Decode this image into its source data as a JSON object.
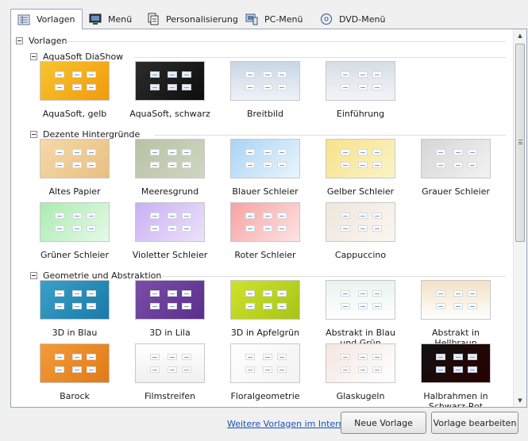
{
  "tabs": [
    {
      "label": "Vorlagen",
      "icon": "templates-icon",
      "active": true
    },
    {
      "label": "Menü",
      "icon": "monitor-icon",
      "active": false
    },
    {
      "label": "Personalisierung",
      "icon": "pages-icon",
      "active": false
    },
    {
      "label": "PC-Menü",
      "icon": "pc-menu-icon",
      "active": false
    },
    {
      "label": "DVD-Menü",
      "icon": "dvd-icon",
      "active": false
    }
  ],
  "tree": {
    "root_label": "Vorlagen",
    "groups": [
      {
        "label": "AquaSoft DiaShow",
        "items": [
          {
            "label": "AquaSoft, gelb",
            "bg": "linear-gradient(135deg,#f7c430,#f29a0c)"
          },
          {
            "label": "AquaSoft, schwarz",
            "bg": "linear-gradient(135deg,#2c2c2c,#0d0d0d)"
          },
          {
            "label": "Breitbild",
            "bg": "linear-gradient(180deg,#c9d6e6,#eef2f8)"
          },
          {
            "label": "Einführung",
            "bg": "linear-gradient(180deg,#d7dde6,#f2f4f8)"
          }
        ]
      },
      {
        "label": "Dezente Hintergründe",
        "items": [
          {
            "label": "Altes Papier",
            "bg": "linear-gradient(135deg,#f5d9a8,#e9bf80)"
          },
          {
            "label": "Meeresgrund",
            "bg": "linear-gradient(135deg,#b8c2a6,#cfd6c0)"
          },
          {
            "label": "Blauer Schleier",
            "bg": "linear-gradient(135deg,#a9d4f5,#eaf5fd)"
          },
          {
            "label": "Gelber Schleier",
            "bg": "linear-gradient(135deg,#f7e28a,#fbf3c8)"
          },
          {
            "label": "Grauer Schleier",
            "bg": "linear-gradient(135deg,#d6d6d6,#f2f2f2)"
          },
          {
            "label": "Grüner Schleier",
            "bg": "linear-gradient(135deg,#a9ecb0,#e6f9e8)"
          },
          {
            "label": "Violetter Schleier",
            "bg": "linear-gradient(135deg,#c9b0f2,#ece2fb)"
          },
          {
            "label": "Roter Schleier",
            "bg": "linear-gradient(135deg,#f6a2a2,#fde3e3)"
          },
          {
            "label": "Cappuccino",
            "bg": "linear-gradient(135deg,#efe6dc,#faf6f1)"
          }
        ]
      },
      {
        "label": "Geometrie und Abstraktion",
        "items": [
          {
            "label": "3D in Blau",
            "bg": "linear-gradient(135deg,#3aa0c9,#1a7aa8)"
          },
          {
            "label": "3D in Lila",
            "bg": "linear-gradient(135deg,#7a4ea8,#5a2f8c)"
          },
          {
            "label": "3D in Apfelgrün",
            "bg": "linear-gradient(135deg,#cfe22a,#a8c41a)"
          },
          {
            "label": "Abstrakt in Blau und Grün",
            "bg": "linear-gradient(180deg,#e8f4f0,#ffffff)"
          },
          {
            "label": "Abstrakt in Hellbraun",
            "bg": "linear-gradient(180deg,#f3e1c6,#ffffff)"
          },
          {
            "label": "Barock",
            "bg": "linear-gradient(135deg,#f39a3a,#e07b17)"
          },
          {
            "label": "Filmstreifen",
            "bg": "linear-gradient(180deg,#ffffff,#f0f0f0)"
          },
          {
            "label": "Floralgeometrie",
            "bg": "linear-gradient(135deg,#ffffff,#f2f2f2)"
          },
          {
            "label": "Glaskugeln",
            "bg": "linear-gradient(135deg,#f4e6e0,#ffffff)"
          },
          {
            "label": "Halbrahmen in Schwarz-Rot",
            "bg": "linear-gradient(135deg,#111111,#2a0000)"
          }
        ]
      }
    ]
  },
  "footer": {
    "link_label": "Weitere Vorlagen im Internet",
    "new_template_label": "Neue Vorlage",
    "edit_template_label": "Vorlage bearbeiten"
  },
  "colors": {
    "link": "#1a4fb5",
    "border": "#9aa6b5"
  }
}
